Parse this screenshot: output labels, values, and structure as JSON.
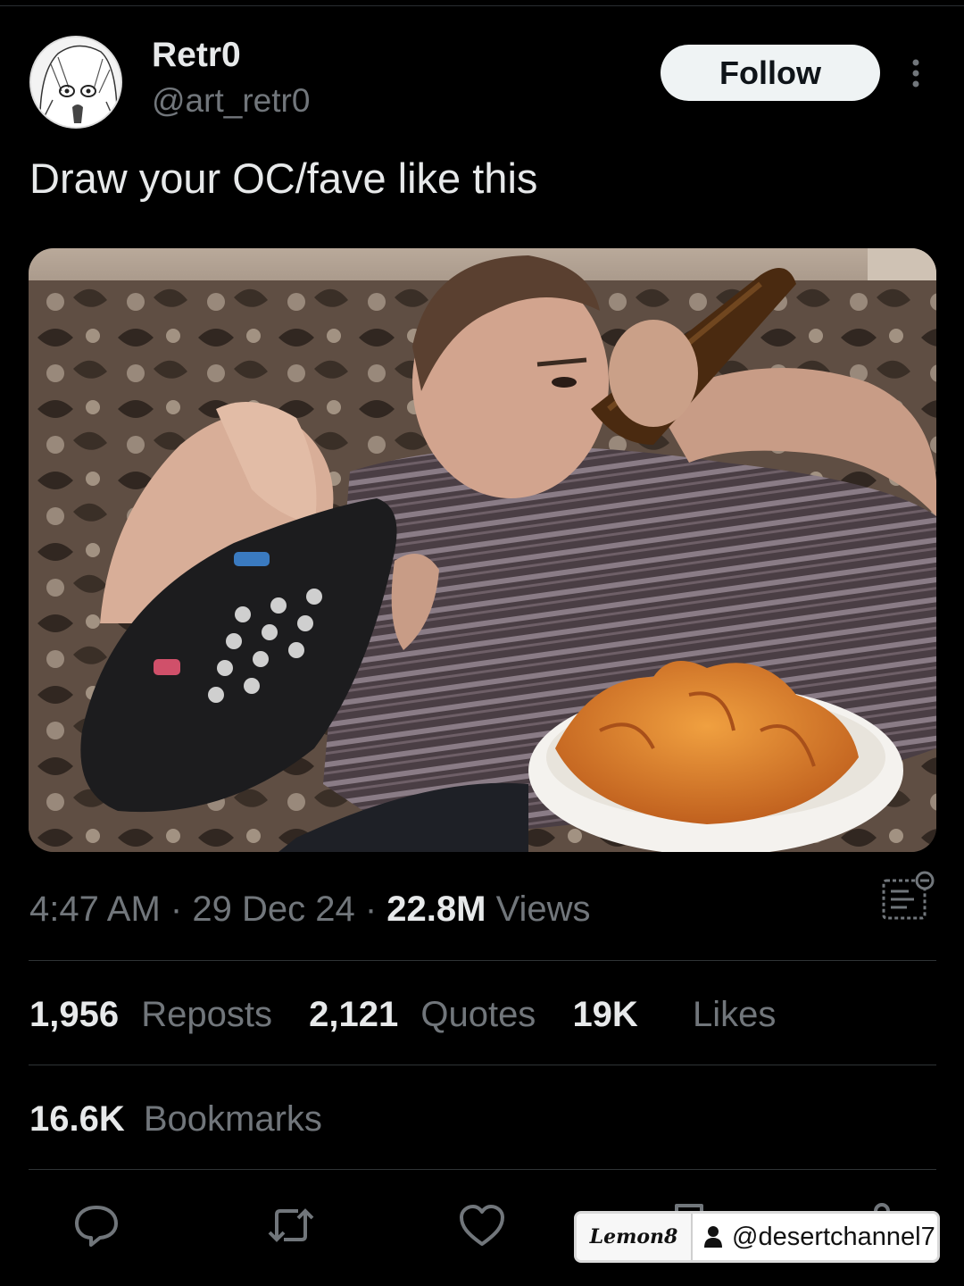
{
  "author": {
    "display_name": "Retr0",
    "handle": "@art_retr0"
  },
  "header": {
    "follow_label": "Follow",
    "more_icon": "more-vertical-icon"
  },
  "tweet": {
    "text": "Draw your OC/fave like this",
    "time": "4:47 AM",
    "separator": "·",
    "date": "29 Dec 24",
    "views_count": "22.8M",
    "views_label": "Views"
  },
  "stats": {
    "reposts_count": "1,956",
    "reposts_label": "Reposts",
    "quotes_count": "2,121",
    "quotes_label": "Quotes",
    "likes_count": "19K",
    "likes_label": "Likes",
    "bookmarks_count": "16.6K",
    "bookmarks_label": "Bookmarks"
  },
  "actions": {
    "reply_icon": "reply-icon",
    "repost_icon": "repost-icon",
    "like_icon": "heart-icon",
    "bookmark_icon": "bookmark-icon",
    "share_icon": "share-icon"
  },
  "watermark": {
    "brand": "Lemon8",
    "user": "@desertchannel7"
  },
  "colors": {
    "background": "#000000",
    "text_primary": "#e7e9ea",
    "text_secondary": "#71767b",
    "divider": "#2f3336",
    "follow_bg": "#eff3f4"
  }
}
